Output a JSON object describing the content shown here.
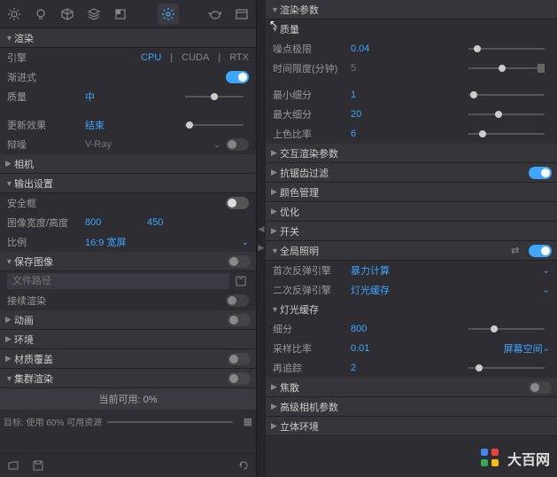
{
  "toolbar": {
    "icons": [
      "sun",
      "bulb",
      "cube",
      "layers",
      "corner",
      "gear",
      "teapot",
      "window"
    ]
  },
  "left": {
    "render_section": "渲染",
    "engine_label": "引擎",
    "engines": [
      "CPU",
      "CUDA",
      "RTX"
    ],
    "engine_active": "CPU",
    "progressive_label": "渐进式",
    "quality_label": "质量",
    "quality_value": "中",
    "update_label": "更新效果",
    "update_value": "结束",
    "denoise_label": "辩噪",
    "denoise_value": "V-Ray",
    "camera_section": "相机",
    "output_section": "输出设置",
    "safeframe_label": "安全框",
    "img_dim_label": "图像宽度/高度",
    "img_w": "800",
    "img_h": "450",
    "ratio_label": "比例",
    "ratio_value": "16:9 宽屏",
    "save_section": "保存图像",
    "filepath_placeholder": "文件路径",
    "docking_label": "接续渲染",
    "anim_section": "动画",
    "env_section": "环境",
    "mat_section": "材质覆盖",
    "cluster_section": "集群渲染",
    "current_usage": "当前可用: 0%",
    "target_label": "目标: 使用 60% 可用资源"
  },
  "right": {
    "params_section": "渲染参数",
    "quality_section": "质量",
    "noise_limit_label": "噪点极限",
    "noise_limit_value": "0.04",
    "time_limit_label": "时间限度(分钟)",
    "time_limit_value": "5",
    "min_subdiv_label": "最小细分",
    "min_subdiv_value": "1",
    "max_subdiv_label": "最大细分",
    "max_subdiv_value": "20",
    "shading_rate_label": "上色比率",
    "shading_rate_value": "6",
    "interactive_section": "交互渲染参数",
    "antialias_section": "抗锯齿过滤",
    "color_section": "颜色管理",
    "optimize_section": "优化",
    "switch_section": "开关",
    "gi_section": "全局照明",
    "primary_engine_label": "首次反弹引擎",
    "primary_engine_value": "暴力计算",
    "secondary_engine_label": "二次反弹引擎",
    "secondary_engine_value": "灯光缓存",
    "lightcache_section": "灯光缓存",
    "subdiv_label": "细分",
    "subdiv_value": "800",
    "sample_label": "采样比率",
    "sample_value": "0.01",
    "sample_mode": "屏幕空间",
    "retrace_label": "再追踪",
    "retrace_value": "2",
    "caustics_section": "焦散",
    "adv_camera_section": "高级相机参数",
    "stereo_section": "立体环境"
  },
  "watermark": "大百网"
}
